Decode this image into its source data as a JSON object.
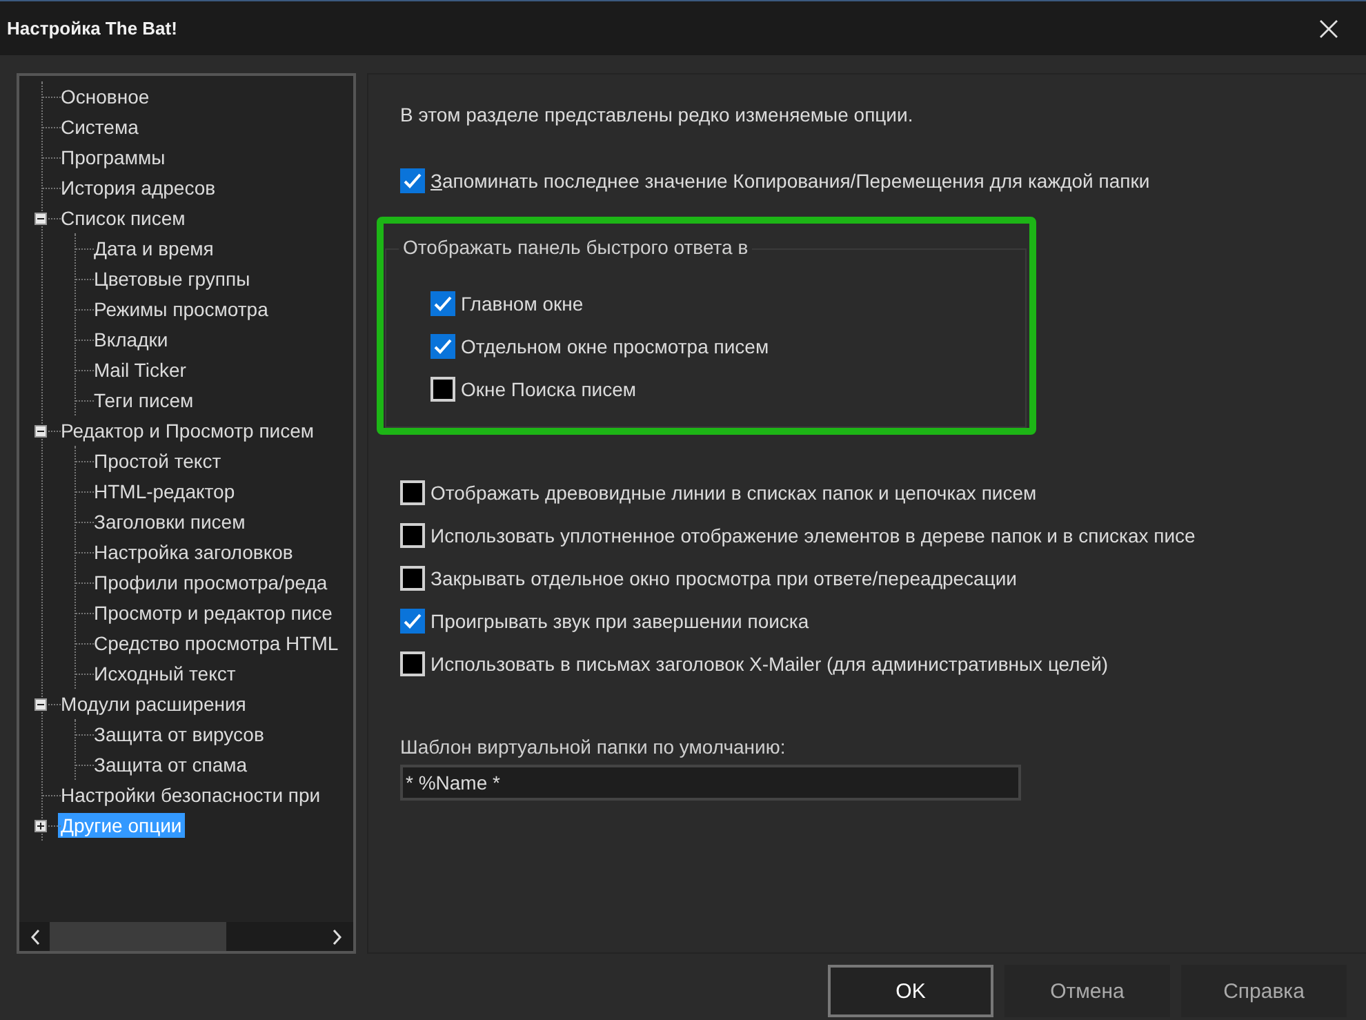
{
  "window": {
    "title": "Настройка The Bat!"
  },
  "tree": [
    {
      "label": "Основное",
      "selected": false
    },
    {
      "label": "Система",
      "selected": false
    },
    {
      "label": "Программы",
      "selected": false
    },
    {
      "label": "История адресов",
      "selected": false
    },
    {
      "label": "Список писем",
      "selected": false,
      "expanded": true,
      "children": [
        {
          "label": "Дата и время",
          "selected": false
        },
        {
          "label": "Цветовые группы",
          "selected": false
        },
        {
          "label": "Режимы просмотра",
          "selected": false
        },
        {
          "label": "Вкладки",
          "selected": false
        },
        {
          "label": "Mail Ticker",
          "selected": false
        },
        {
          "label": "Теги писем",
          "selected": false
        }
      ]
    },
    {
      "label": "Редактор и Просмотр писем",
      "selected": false,
      "expanded": true,
      "children": [
        {
          "label": "Простой текст",
          "selected": false
        },
        {
          "label": "HTML-редактор",
          "selected": false
        },
        {
          "label": "Заголовки писем",
          "selected": false
        },
        {
          "label": "Настройка заголовков",
          "selected": false
        },
        {
          "label": "Профили просмотра/реда",
          "selected": false
        },
        {
          "label": "Просмотр и редактор писе",
          "selected": false
        },
        {
          "label": "Средство просмотра HTML",
          "selected": false
        },
        {
          "label": "Исходный текст",
          "selected": false
        }
      ]
    },
    {
      "label": "Модули расширения",
      "selected": false,
      "expanded": true,
      "children": [
        {
          "label": "Защита от вирусов",
          "selected": false
        },
        {
          "label": "Защита от спама",
          "selected": false
        }
      ]
    },
    {
      "label": "Настройки безопасности при",
      "selected": false
    },
    {
      "label": "Другие опции",
      "selected": true,
      "expanded": false
    }
  ],
  "intro": "В этом разделе представлены редко изменяемые опции.",
  "remember_option": {
    "label": "Запоминать последнее значение Копирования/Перемещения для каждой папки",
    "checked": true,
    "first_letter_underlined": true
  },
  "quick_reply_group": {
    "title": "Отображать панель быстрого ответа в",
    "highlighted": true,
    "options": [
      {
        "label": "Главном окне",
        "checked": true
      },
      {
        "label": "Отдельном окне просмотра писем",
        "checked": true
      },
      {
        "label": "Окне Поиска писем",
        "checked": false
      }
    ]
  },
  "options": [
    {
      "label": "Отображать древовидные линии в списках папок и цепочках писем",
      "checked": false
    },
    {
      "label": "Использовать уплотненное отображение элементов в дереве папок и в списках писе",
      "checked": false
    },
    {
      "label": "Закрывать отдельное окно просмотра при ответе/переадресации",
      "checked": false
    },
    {
      "label": "Проигрывать звук при завершении поиска",
      "checked": true
    },
    {
      "label": "Использовать в письмах заголовок X-Mailer (для административных целей)",
      "checked": false
    }
  ],
  "template_field": {
    "label": "Шаблон виртуальной папки по умолчанию:",
    "value": "* %Name *"
  },
  "buttons": [
    {
      "label": "OK",
      "default": true
    },
    {
      "label": "Отмена",
      "default": false
    },
    {
      "label": "Справка",
      "default": false
    }
  ]
}
